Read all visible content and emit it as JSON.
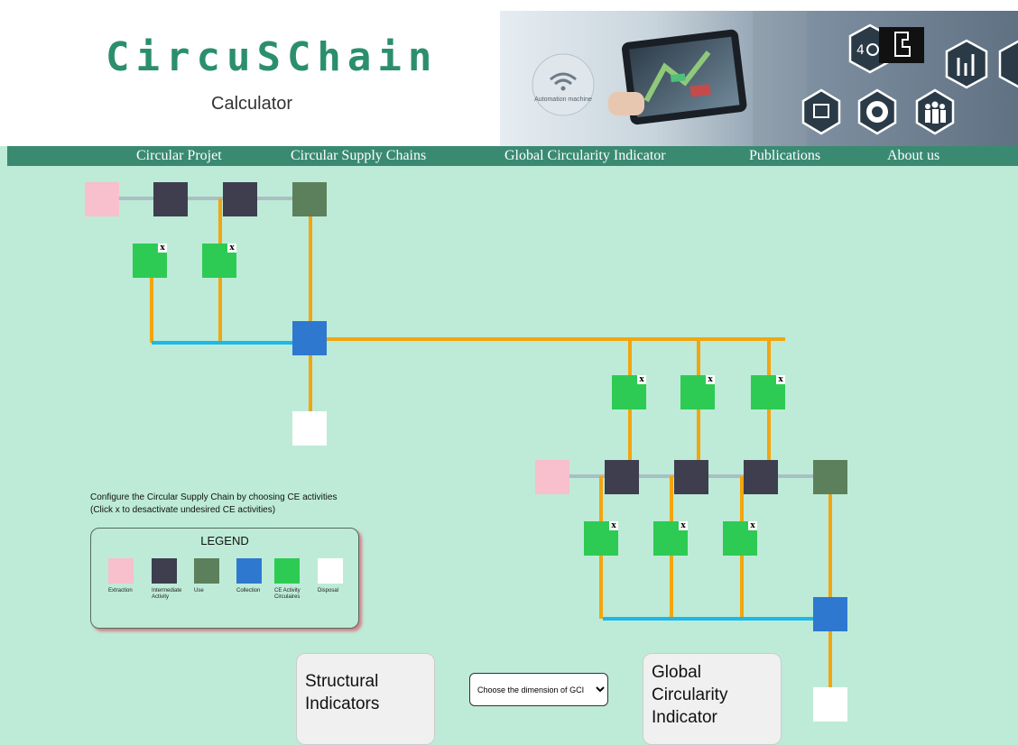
{
  "header": {
    "logo": "CircuSChain",
    "subtitle": "Calculator",
    "banner": {
      "tablet_label": "Automation machine",
      "badge_label": "4"
    }
  },
  "nav": {
    "items": [
      {
        "label": "Circular Projet"
      },
      {
        "label": "Circular Supply Chains"
      },
      {
        "label": "Global Circularity Indicator"
      },
      {
        "label": "Publications"
      },
      {
        "label": "About us"
      }
    ]
  },
  "colors": {
    "extraction": "#f8bfcc",
    "intermediate": "#3e3e4e",
    "use": "#5c805b",
    "collection": "#2e78d0",
    "ce_activity": "#2dcb53",
    "disposal": "#ffffff",
    "flow_orange": "#f3a50f",
    "flow_blue": "#1cb8e8",
    "flow_grey": "#a9bfc4"
  },
  "remove_mark": "x",
  "instructions": {
    "line1": "Configure the Circular Supply Chain by choosing CE activities",
    "line2": "(Click x to desactivate undesired CE activities)"
  },
  "legend": {
    "title": "LEGEND",
    "items": [
      {
        "label": "Extraction",
        "type": "extraction"
      },
      {
        "label": "Intermediate Activity",
        "type": "intermediate"
      },
      {
        "label": "Use",
        "type": "use"
      },
      {
        "label": "Collection",
        "type": "collection"
      },
      {
        "label": "CE Activity Circulaires",
        "type": "ce_activity"
      },
      {
        "label": "Disposal",
        "type": "disposal"
      }
    ]
  },
  "cards": {
    "structural": {
      "line1": "Structural",
      "line2": "Indicators"
    },
    "global": {
      "line1": "Global",
      "line2": "Circularity",
      "line3": "Indicator"
    }
  },
  "dimension_select": {
    "selected": "Choose the dimension of GCI"
  }
}
